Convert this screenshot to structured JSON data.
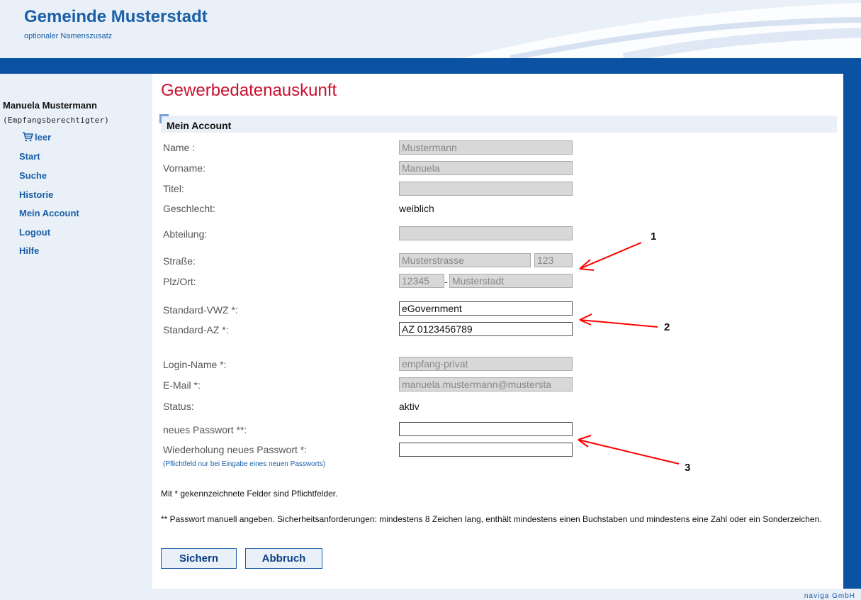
{
  "header": {
    "title": "Gemeinde Musterstadt",
    "subtitle": "optionaler Namenszusatz"
  },
  "sidebar": {
    "user_name": "Manuela Mustermann",
    "user_role": "(Empfangsberechtigter)",
    "cart_label": "leer",
    "items": [
      {
        "label": "Start"
      },
      {
        "label": "Suche"
      },
      {
        "label": "Historie"
      },
      {
        "label": "Mein Account"
      },
      {
        "label": "Logout"
      },
      {
        "label": "Hilfe"
      }
    ]
  },
  "main": {
    "heading": "Gewerbedatenauskunft",
    "section_title": "Mein Account",
    "fields": {
      "name": {
        "label": "Name :",
        "value": "Mustermann"
      },
      "vorname": {
        "label": "Vorname:",
        "value": "Manuela"
      },
      "titel": {
        "label": "Titel:",
        "value": ""
      },
      "geschlecht": {
        "label": "Geschlecht:",
        "value": "weiblich"
      },
      "abteilung": {
        "label": "Abteilung:",
        "value": ""
      },
      "strasse": {
        "label": "Straße:",
        "value": "Musterstrasse",
        "number": "123"
      },
      "plzort": {
        "label": "Plz/Ort:",
        "plz": "12345",
        "separator": "-",
        "ort": "Musterstadt"
      },
      "standard_vwz": {
        "label": "Standard-VWZ *:",
        "value": "eGovernment"
      },
      "standard_az": {
        "label": "Standard-AZ *:",
        "value": "AZ 0123456789"
      },
      "login_name": {
        "label": "Login-Name *:",
        "value": "empfang-privat"
      },
      "email": {
        "label": "E-Mail *:",
        "value": "manuela.mustermann@mustersta"
      },
      "status": {
        "label": "Status:",
        "value": "aktiv"
      },
      "neues_passwort": {
        "label": "neues Passwort **:",
        "value": ""
      },
      "wiederholung": {
        "label": "Wiederholung neues Passwort *:",
        "value": "",
        "note": "(Pflichtfeld nur bei Eingabe eines neuen Passworts)"
      }
    },
    "info_required": "Mit * gekennzeichnete Felder sind Pflichtfelder.",
    "info_password": "** Passwort manuell angeben. Sicherheitsanforderungen: mindestens 8 Zeichen lang, enthält mindestens einen Buchstaben und mindestens eine Zahl oder ein Sonderzeichen.",
    "buttons": {
      "save": "Sichern",
      "cancel": "Abbruch"
    }
  },
  "annotations": [
    "1",
    "2",
    "3"
  ],
  "footer": {
    "brand": "naviga GmbH"
  },
  "colors": {
    "brand_blue": "#1a5fa8",
    "bar_blue": "#0b52a3",
    "panel_bg": "#eaf0f8",
    "heading_red": "#c8102e",
    "annotation_red": "#ff0000"
  }
}
